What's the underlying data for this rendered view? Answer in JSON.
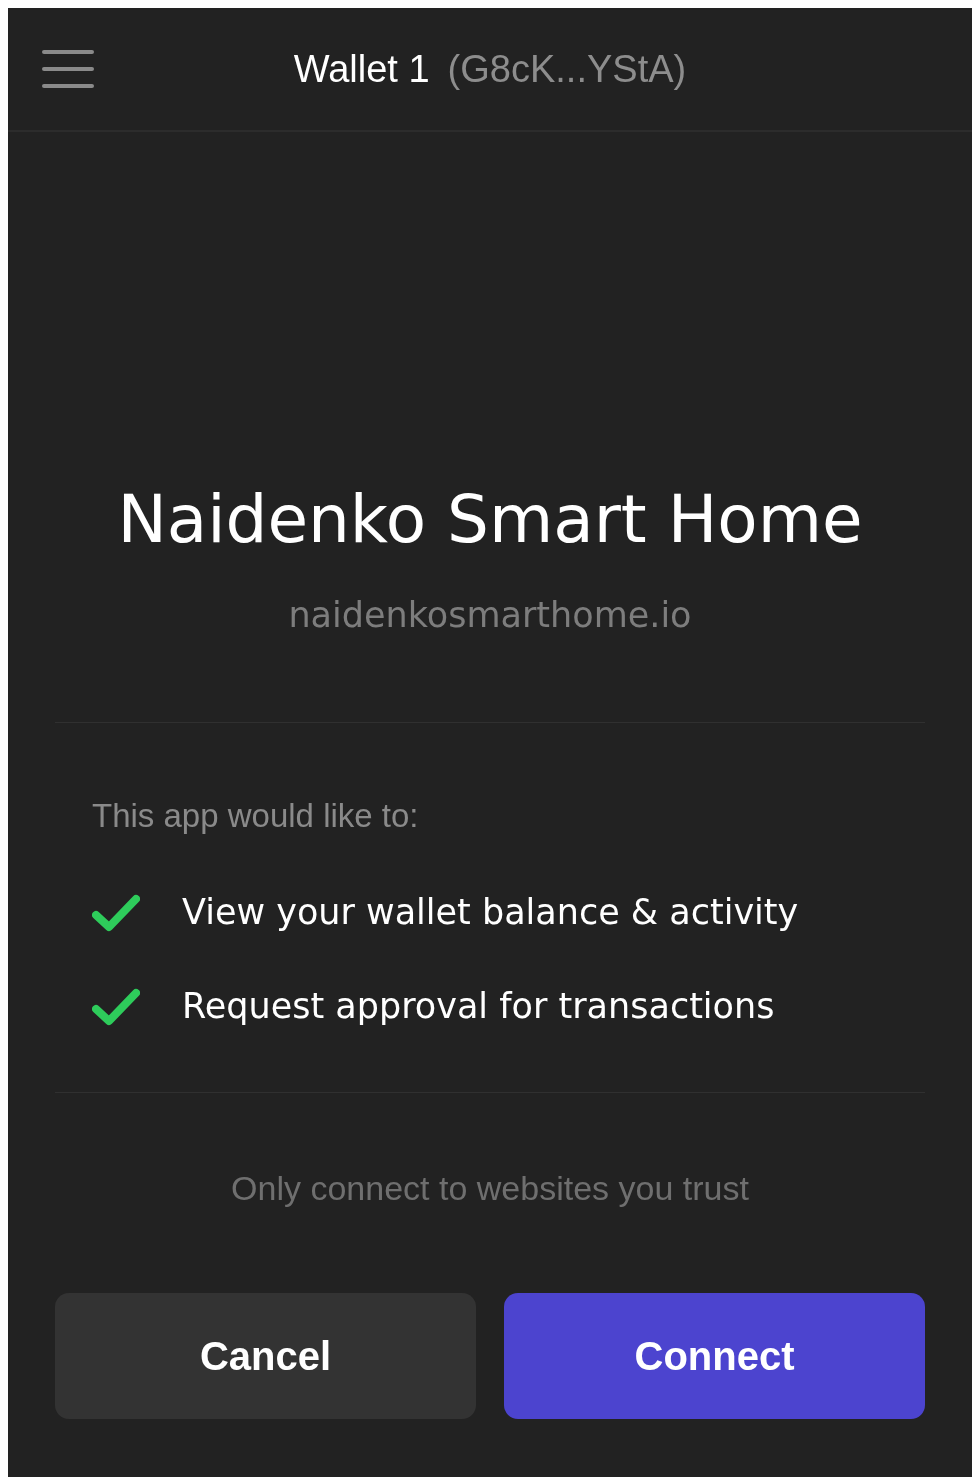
{
  "header": {
    "wallet_name": "Wallet 1",
    "address": "(G8cK...YStA)"
  },
  "app": {
    "name": "Naidenko Smart Home",
    "domain": "naidenkosmarthome.io"
  },
  "permissions": {
    "heading": "This app would like to:",
    "items": [
      {
        "label": "View your wallet balance & activity",
        "granted": true
      },
      {
        "label": "Request approval for transactions",
        "granted": true
      }
    ]
  },
  "notice": "Only connect to websites you trust",
  "buttons": [
    {
      "label": "Cancel",
      "kind": "secondary"
    },
    {
      "label": "Connect",
      "kind": "primary"
    }
  ]
}
